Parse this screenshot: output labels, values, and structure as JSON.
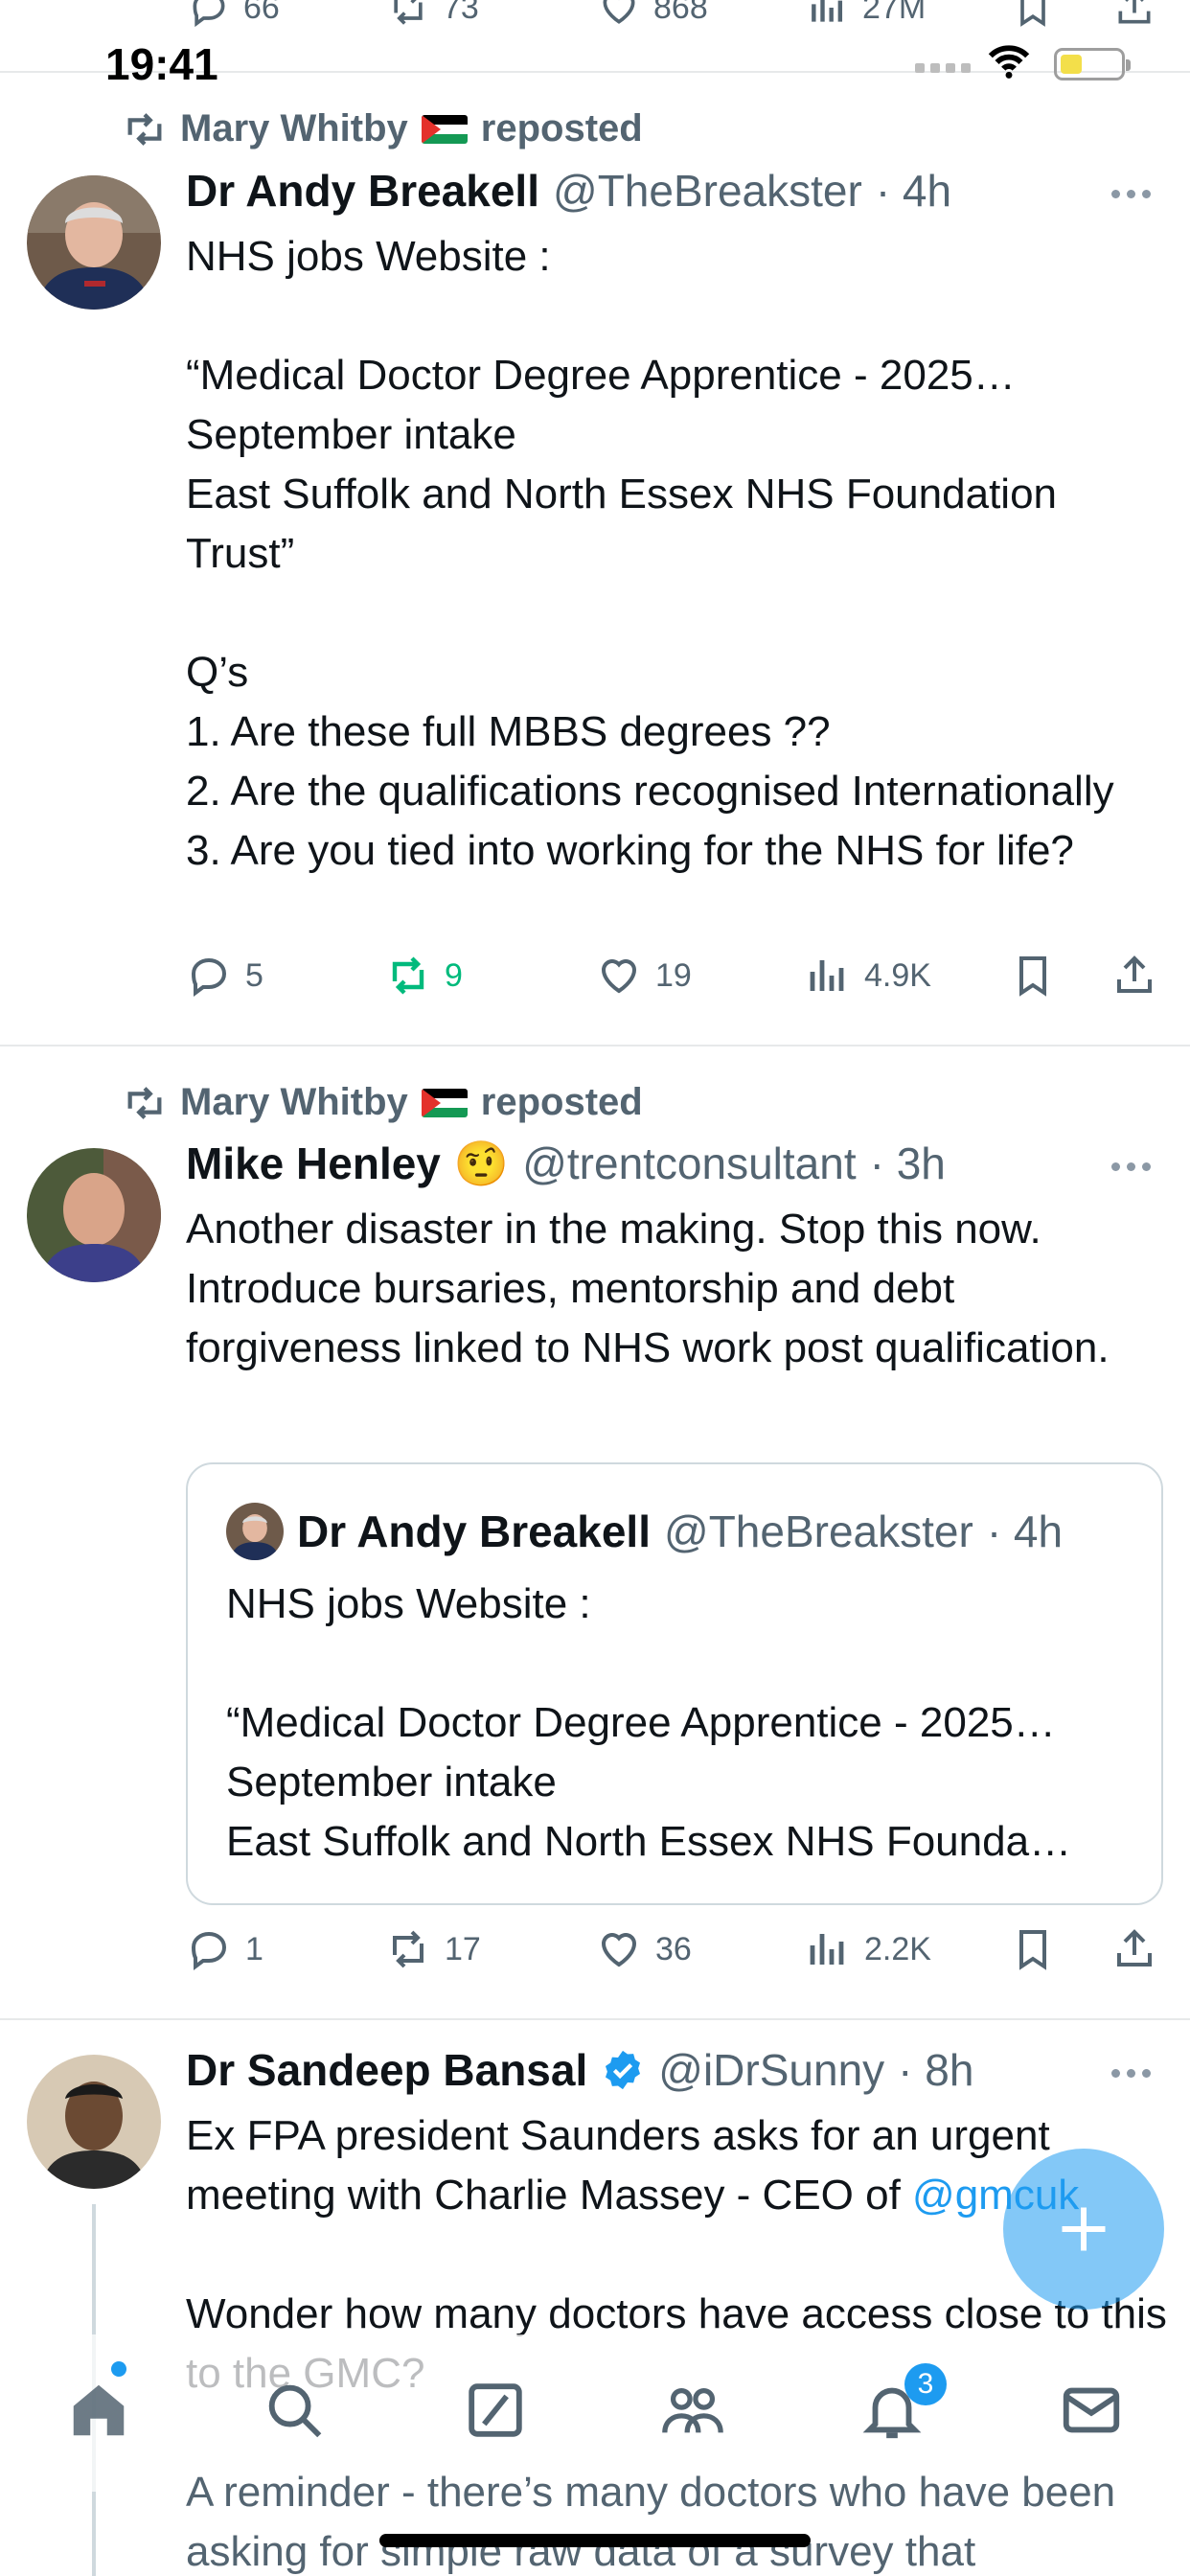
{
  "status_bar": {
    "time": "19:41"
  },
  "top_partial_actions": {
    "replies": "66",
    "reposts": "73",
    "likes": "868",
    "views": "27M"
  },
  "tweets": [
    {
      "reposted_by": "Mary Whitby",
      "reposted_label": "reposted",
      "name": "Dr Andy Breakell",
      "handle": "@TheBreakster",
      "time": "· 4h",
      "body": "NHS jobs Website :\n\n“Medical Doctor Degree Apprentice - 2025…\nSeptember intake\nEast Suffolk and North Essex NHS Foundation Trust”\n\nQ’s\n1. Are these full MBBS degrees ??\n2. Are the qualifications recognised Internationally\n3. Are you tied into working for the NHS for life?",
      "replies": "5",
      "reposts": "9",
      "likes": "19",
      "views": "4.9K"
    },
    {
      "reposted_by": "Mary Whitby",
      "reposted_label": "reposted",
      "name": "Mike Henley",
      "emoji": "🤨",
      "handle": "@trentconsultant",
      "time": "· 3h",
      "body": "Another disaster in the making. Stop this now. Introduce bursaries, mentorship and debt forgiveness linked to NHS work post qualification.",
      "quote": {
        "name": "Dr Andy Breakell",
        "handle": "@TheBreakster",
        "time": "· 4h",
        "body": "NHS jobs Website :\n\n“Medical Doctor Degree Apprentice - 2025…September intake\nEast Suffolk and North Essex NHS Founda…"
      },
      "replies": "1",
      "reposts": "17",
      "likes": "36",
      "views": "2.2K"
    },
    {
      "name": "Dr Sandeep Bansal",
      "handle": "@iDrSunny",
      "time": "· 8h",
      "body_part1": "Ex FPA president Saunders asks for an urgent meeting with Charlie Massey - CEO of ",
      "mention": "@gmcuk",
      "body_part2": "Wonder how many doctors have access close to this to the GMC?",
      "faded_body": "A reminder - there’s many doctors who have been asking for simple raw data of a survey that"
    }
  ],
  "tabbar": {
    "notifications_badge": "3"
  },
  "colors": {
    "accent": "#1d9bf0",
    "repost_green": "#00ba7c",
    "secondary_text": "#536471"
  }
}
